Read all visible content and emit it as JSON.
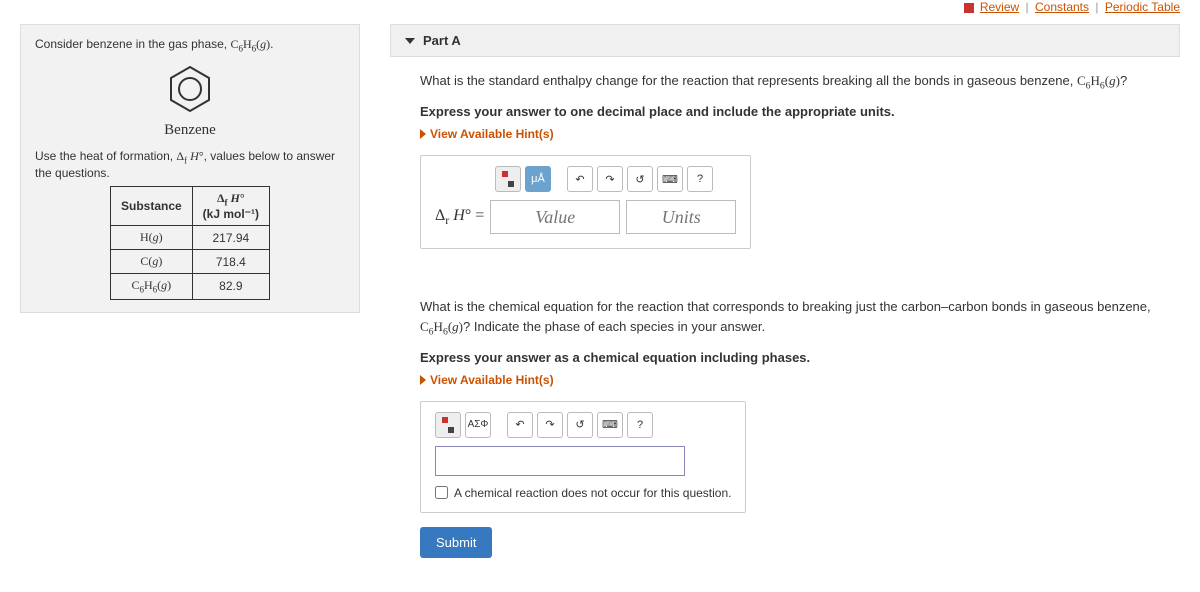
{
  "top_links": {
    "review": " Review",
    "constants": "Constants",
    "periodic": "Periodic Table"
  },
  "context": {
    "intro_a": "Consider benzene in the gas phase, ",
    "intro_b": ".",
    "benzene_label": "Benzene",
    "heat_line_a": "Use the heat of formation, ",
    "heat_line_b": ", values below to answer the questions.",
    "formula_c6h6g": "C₆H₆(g)",
    "delta_fH": "Δf H°",
    "table": {
      "h_substance": "Substance",
      "h_dfh_a": "Δf H°",
      "h_dfh_b": "(kJ mol⁻¹)",
      "rows": [
        {
          "s": "H(g)",
          "v": "217.94"
        },
        {
          "s": "C(g)",
          "v": "718.4"
        },
        {
          "s": "C₆H₆(g)",
          "v": "82.9"
        }
      ]
    }
  },
  "part": {
    "label": "Part A",
    "q1_a": "What is the standard enthalpy change for the reaction that represents breaking all the bonds in gaseous benzene, ",
    "q1_b": "?",
    "instr1": "Express your answer to one decimal place and include the appropriate units.",
    "hints": "View Available Hint(s)",
    "prefix": "Δr H° =",
    "value_ph": "Value",
    "units_ph": "Units",
    "tool_mu": "μÅ",
    "tool_undo": "↶",
    "tool_redo": "↷",
    "tool_reset": "↺",
    "tool_kbd": "⌨",
    "tool_help": "?",
    "tool_greek": "ΑΣΦ",
    "q2_a": "What is the chemical equation for the reaction that corresponds to breaking just the carbon–carbon bonds in gaseous benzene, ",
    "q2_b": "? Indicate the phase of each species in your answer.",
    "instr2": "Express your answer as a chemical equation including phases.",
    "checkbox_label": "A chemical reaction does not occur for this question.",
    "submit": "Submit"
  }
}
